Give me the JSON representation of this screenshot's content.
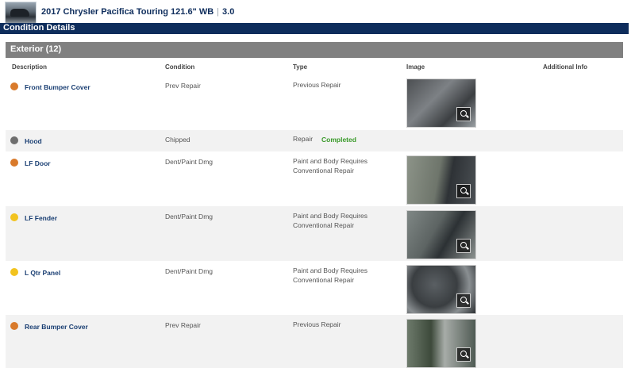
{
  "header": {
    "vehicle_title": "2017 Chrysler Pacifica Touring 121.6\" WB",
    "grade": "3.0"
  },
  "nav": {
    "title": "Condition Details"
  },
  "section": {
    "title": "Exterior (12)"
  },
  "columns": [
    "Description",
    "Condition",
    "Type",
    "Image",
    "Additional Info"
  ],
  "colors": {
    "orange": "#d97a2b",
    "gray": "#6e6e6e",
    "yellow": "#f2c31f",
    "nav_blue": "#0e2d5c",
    "completed_green": "#3a9a2a"
  },
  "rows": [
    {
      "description": "Front Bumper Cover",
      "severity": "orange",
      "condition": "Prev Repair",
      "type": [
        "Previous Repair"
      ],
      "status": "",
      "has_image": true
    },
    {
      "description": "Hood",
      "severity": "gray",
      "condition": "Chipped",
      "type": [
        "Repair"
      ],
      "status": "Completed",
      "has_image": false
    },
    {
      "description": "LF Door",
      "severity": "orange",
      "condition": "Dent/Paint Dmg",
      "type": [
        "Paint and Body Requires",
        "Conventional Repair"
      ],
      "status": "",
      "has_image": true
    },
    {
      "description": "LF Fender",
      "severity": "yellow",
      "condition": "Dent/Paint Dmg",
      "type": [
        "Paint and Body Requires",
        "Conventional Repair"
      ],
      "status": "",
      "has_image": true
    },
    {
      "description": "L Qtr Panel",
      "severity": "yellow",
      "condition": "Dent/Paint Dmg",
      "type": [
        "Paint and Body Requires",
        "Conventional Repair"
      ],
      "status": "",
      "has_image": true
    },
    {
      "description": "Rear Bumper Cover",
      "severity": "orange",
      "condition": "Prev Repair",
      "type": [
        "Previous Repair"
      ],
      "status": "",
      "has_image": true
    }
  ]
}
